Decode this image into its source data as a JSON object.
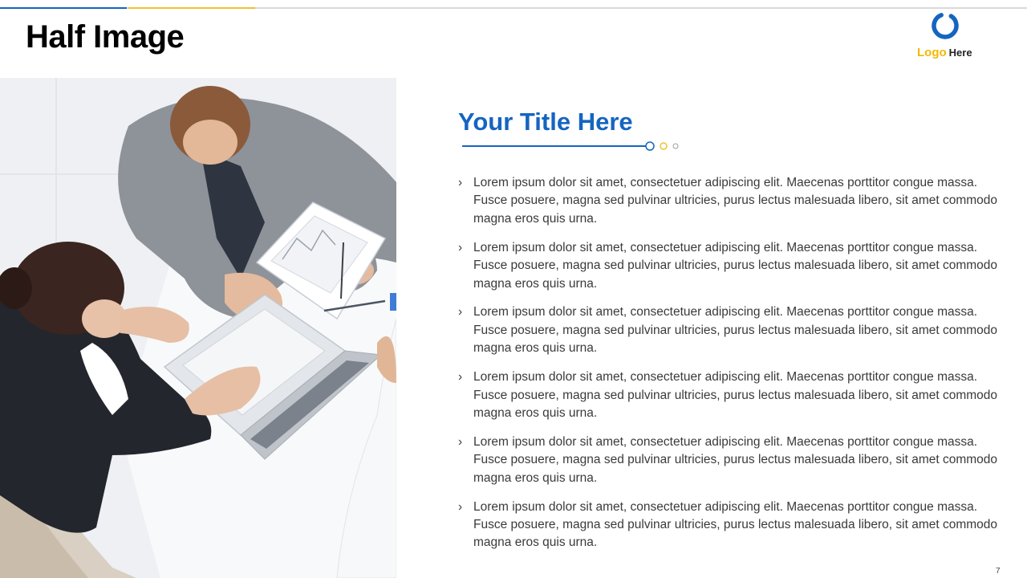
{
  "slide": {
    "title": "Half Image",
    "page_number": "7"
  },
  "logo": {
    "part1": "Logo",
    "part2": "Here",
    "icon": "ring-logo-icon"
  },
  "content": {
    "title": "Your Title Here",
    "bullet_icon": "chevron-right-icon",
    "bullets": [
      "Lorem ipsum dolor sit amet, consectetuer adipiscing elit.  Maecenas porttitor congue massa. Fusce posuere, magna sed pulvinar ultricies, purus lectus malesuada libero, sit amet commodo magna eros quis urna.",
      "Lorem ipsum dolor sit amet, consectetuer adipiscing elit.  Maecenas porttitor congue massa. Fusce posuere, magna sed pulvinar ultricies, purus lectus malesuada libero, sit amet commodo magna eros quis urna.",
      "Lorem ipsum dolor sit amet, consectetuer adipiscing elit.  Maecenas porttitor congue massa. Fusce posuere, magna sed pulvinar ultricies, purus lectus malesuada libero, sit amet commodo magna eros quis urna.",
      "Lorem ipsum dolor sit amet, consectetuer adipiscing elit.  Maecenas porttitor congue massa. Fusce posuere, magna sed pulvinar ultricies, purus lectus malesuada libero, sit amet commodo magna eros quis urna.",
      "Lorem ipsum dolor sit amet, consectetuer adipiscing elit.  Maecenas porttitor congue massa. Fusce posuere, magna sed pulvinar ultricies, purus lectus malesuada libero, sit amet commodo magna eros quis urna.",
      "Lorem ipsum dolor sit amet, consectetuer adipiscing elit.  Maecenas porttitor congue massa. Fusce posuere, magna sed pulvinar ultricies, purus lectus malesuada libero, sit amet commodo magna eros quis urna."
    ]
  },
  "colors": {
    "accent_blue": "#1565c0",
    "accent_yellow": "#f2c12e",
    "text_dark": "#3a3a3a"
  }
}
